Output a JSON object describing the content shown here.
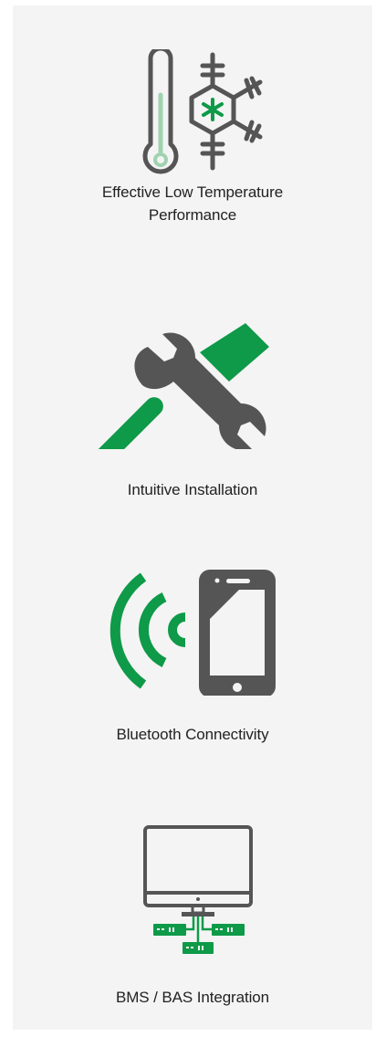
{
  "colors": {
    "panel_background": "#f4f4f4",
    "icon_gray": "#555555",
    "icon_green": "#0e9a48",
    "icon_light_green": "#9fd3b0",
    "text": "#222222"
  },
  "features": [
    {
      "icon": "thermometer-snowflake-icon",
      "label": "Effective Low Temperature Performance"
    },
    {
      "icon": "wrench-hammer-icon",
      "label": "Intuitive Installation"
    },
    {
      "icon": "bluetooth-phone-icon",
      "label": "Bluetooth Connectivity"
    },
    {
      "icon": "monitor-network-icon",
      "label": "BMS / BAS Integration"
    }
  ]
}
